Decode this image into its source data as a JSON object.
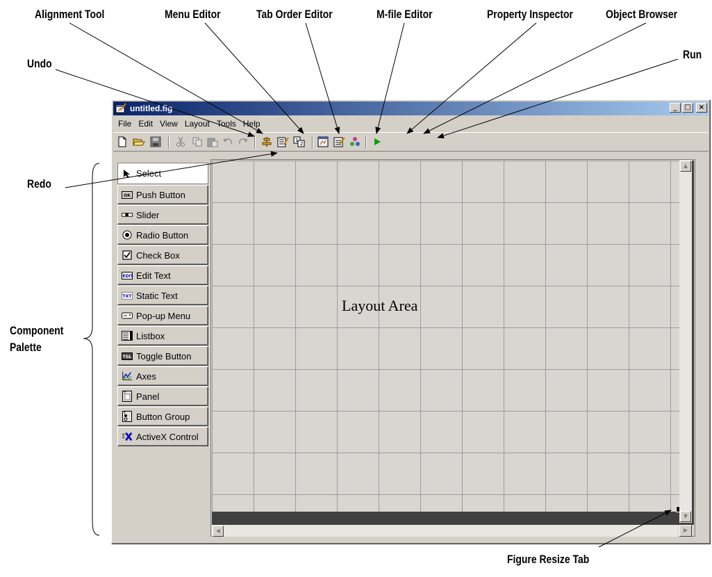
{
  "window": {
    "title": "untitled.fig",
    "controls": [
      "_",
      "□",
      "×"
    ]
  },
  "menubar": [
    "File",
    "Edit",
    "View",
    "Layout",
    "Tools",
    "Help"
  ],
  "toolbar": {
    "items": [
      "new-icon",
      "open-icon",
      "save-icon",
      "cut-icon",
      "copy-icon",
      "paste-icon",
      "undo-icon",
      "redo-icon",
      "alignment-tool-icon",
      "menu-editor-icon",
      "tab-order-editor-icon",
      "mfile-editor-icon",
      "property-inspector-icon",
      "object-browser-icon",
      "run-icon"
    ]
  },
  "palette": {
    "items": [
      "Select",
      "Push Button",
      "Slider",
      "Radio Button",
      "Check Box",
      "Edit Text",
      "Static Text",
      "Pop-up Menu",
      "Listbox",
      "Toggle Button",
      "Axes",
      "Panel",
      "Button Group",
      "ActiveX Control"
    ]
  },
  "layout_area_label": "Layout Area",
  "callouts": {
    "alignment_tool": "Alignment Tool",
    "menu_editor": "Menu Editor",
    "tab_order_editor": "Tab Order Editor",
    "mfile_editor": "M-file Editor",
    "property_inspector": "Property Inspector",
    "object_browser": "Object Browser",
    "run": "Run",
    "undo": "Undo",
    "redo": "Redo",
    "component_palette_1": "Component",
    "component_palette_2": "Palette",
    "figure_resize_tab": "Figure Resize Tab"
  },
  "colors": {
    "face": "#d4d0c8",
    "title_start": "#0a246a",
    "title_end": "#a6caf0",
    "canvas_border": "#404040",
    "grid_line": "#9c9c9c",
    "run_green": "#00a000"
  }
}
